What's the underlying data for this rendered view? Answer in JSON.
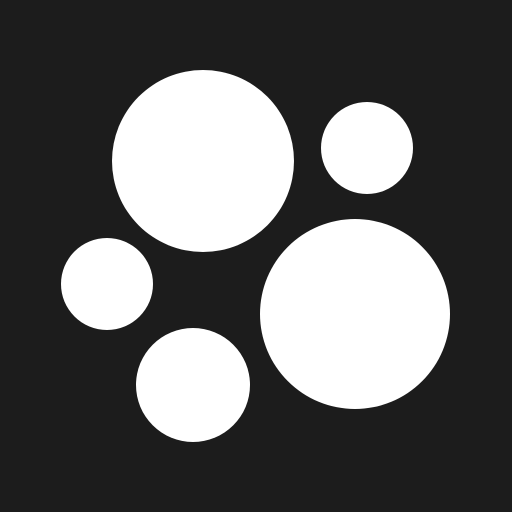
{
  "colors": {
    "background": "#1c1c1c",
    "circle": "#ffffff"
  },
  "icon": "five-dots-logo-icon"
}
